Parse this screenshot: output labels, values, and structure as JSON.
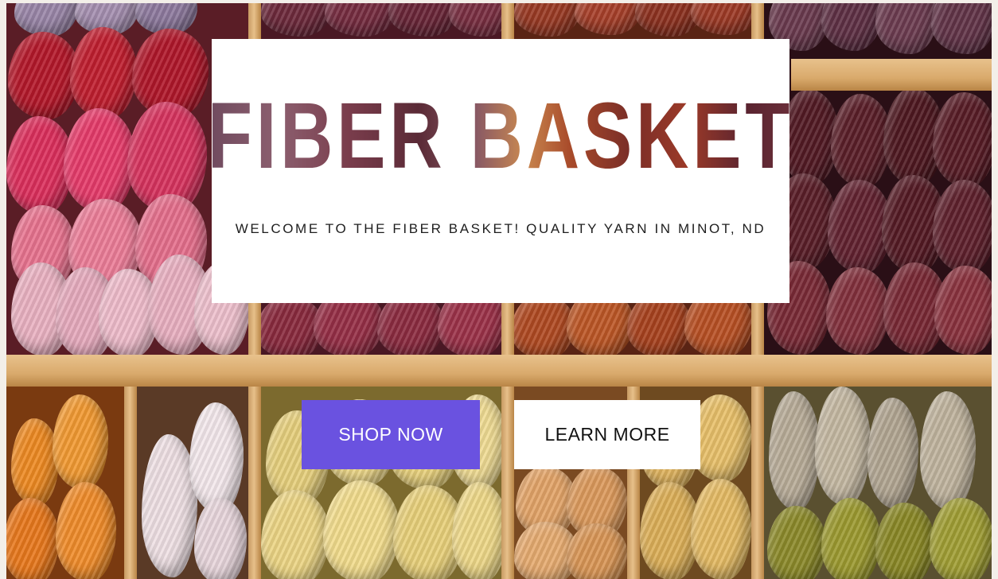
{
  "hero": {
    "brand": "FIBER BASKET",
    "tagline": "WELCOME TO THE FIBER BASKET! QUALITY YARN IN MINOT, ND"
  },
  "buttons": {
    "shop_label": "SHOP NOW",
    "learn_label": "LEARN MORE"
  },
  "colors": {
    "shop_button": "#6a52e0",
    "card": "#ffffff",
    "shelf_wood": "#d9aa6c"
  }
}
